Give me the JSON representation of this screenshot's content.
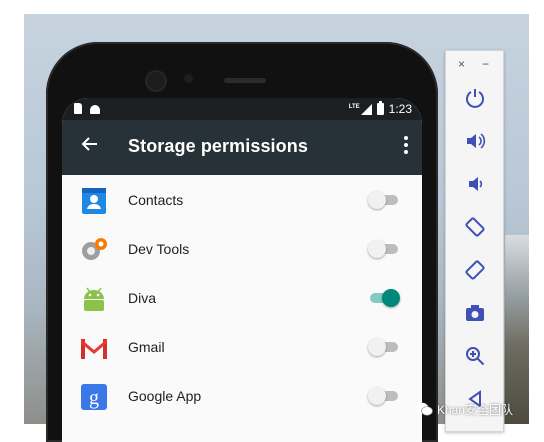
{
  "status_bar": {
    "network": "LTE",
    "time": "1:23"
  },
  "app_bar": {
    "title": "Storage permissions"
  },
  "apps": [
    {
      "label": "Contacts",
      "icon": "contacts-icon",
      "enabled": false
    },
    {
      "label": "Dev Tools",
      "icon": "dev-tools-icon",
      "enabled": false
    },
    {
      "label": "Diva",
      "icon": "android-icon",
      "enabled": true
    },
    {
      "label": "Gmail",
      "icon": "gmail-icon",
      "enabled": false
    },
    {
      "label": "Google App",
      "icon": "google-icon",
      "enabled": false
    }
  ],
  "emulator_toolbar": {
    "close": "×",
    "minimize": "−",
    "buttons": [
      "power-icon",
      "volume-up-icon",
      "volume-down-icon",
      "rotate-left-icon",
      "rotate-right-icon",
      "camera-icon",
      "zoom-in-icon",
      "back-icon"
    ]
  },
  "watermark": {
    "text": "Khan安全团队"
  },
  "colors": {
    "app_bar": "#263238",
    "switch_on": "#00897b",
    "switch_on_track": "#80cbc4",
    "toolbar_icon": "#3f51b5"
  }
}
